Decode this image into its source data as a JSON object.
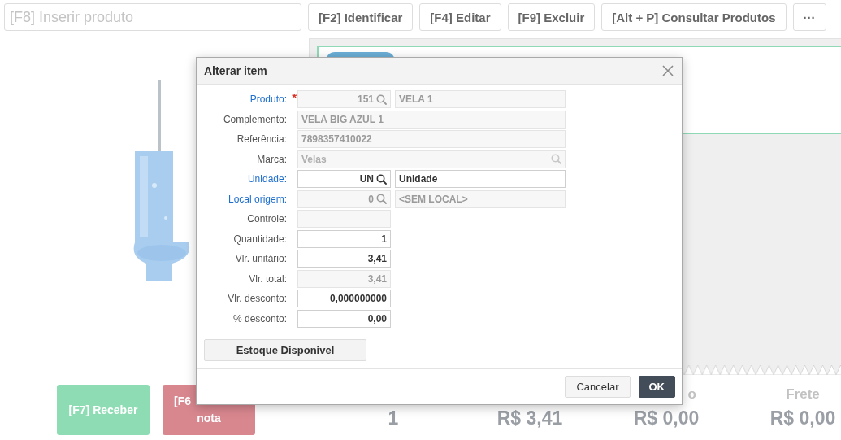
{
  "toolbar": {
    "search": {
      "placeholder": "[F8] Inserir produto"
    },
    "buttons": [
      "[F2] Identificar",
      "[F4] Editar",
      "[F9] Excluir",
      "[Alt + P] Consultar Produtos",
      "···"
    ]
  },
  "actions": [
    {
      "lines": [
        "[F7] Receber"
      ],
      "color": "#8ddcb3"
    },
    {
      "lines": [
        "[F6",
        "nota"
      ],
      "color": "#d9878f"
    }
  ],
  "totals": [
    {
      "value": "1"
    },
    {
      "value": "R$ 3,41"
    },
    {
      "label": "o",
      "value": "R$ 0,00"
    },
    {
      "label": "Frete",
      "value": "R$ 0,00"
    }
  ],
  "dialog": {
    "title": "Alterar item",
    "fields": [
      {
        "label": "Produto:",
        "link": true,
        "required_mark": "*",
        "inputs": [
          {
            "kind": "code",
            "value": "151",
            "search": true,
            "disabled": true
          },
          {
            "kind": "text",
            "value": "VELA 1",
            "disabled": true
          }
        ]
      },
      {
        "label": "Complemento:",
        "link": false,
        "inputs": [
          {
            "kind": "text",
            "value": "VELA BIG AZUL 1",
            "disabled": true
          }
        ]
      },
      {
        "label": "Referência:",
        "link": false,
        "inputs": [
          {
            "kind": "text",
            "value": "7898357410022",
            "disabled": true
          }
        ]
      },
      {
        "label": "Marca:",
        "link": false,
        "inputs": [
          {
            "kind": "text",
            "placeholder": "Velas",
            "search": true,
            "disabled": true
          }
        ]
      },
      {
        "label": "Unidade:",
        "link": true,
        "inputs": [
          {
            "kind": "code",
            "value": "UN",
            "search": true,
            "disabled": false
          },
          {
            "kind": "text",
            "value": "Unidade",
            "disabled": false
          }
        ]
      },
      {
        "label": "Local origem:",
        "link": true,
        "inputs": [
          {
            "kind": "code",
            "value": "0",
            "search": true,
            "disabled": true
          },
          {
            "kind": "text",
            "value": "<SEM LOCAL>",
            "disabled": true
          }
        ]
      },
      {
        "label": "Controle:",
        "link": false,
        "inputs": [
          {
            "kind": "code",
            "disabled": true
          }
        ]
      },
      {
        "label": "Quantidade:",
        "link": false,
        "inputs": [
          {
            "kind": "code",
            "value": "1",
            "disabled": false
          }
        ]
      },
      {
        "label": "Vlr. unitário:",
        "link": false,
        "inputs": [
          {
            "kind": "code",
            "value": "3,41",
            "disabled": false
          }
        ]
      },
      {
        "label": "Vlr. total:",
        "link": false,
        "inputs": [
          {
            "kind": "code",
            "value": "3,41",
            "disabled": true
          }
        ]
      },
      {
        "label": "Vlr. desconto:",
        "link": false,
        "inputs": [
          {
            "kind": "code",
            "value": "0,000000000",
            "disabled": false
          }
        ]
      },
      {
        "label": "% desconto:",
        "link": false,
        "inputs": [
          {
            "kind": "code",
            "value": "0,00",
            "disabled": false
          }
        ]
      }
    ],
    "body_button": "Estoque Disponivel",
    "footer_buttons": [
      {
        "label": "Cancelar",
        "primary": false
      },
      {
        "label": "OK",
        "primary": true
      }
    ]
  }
}
